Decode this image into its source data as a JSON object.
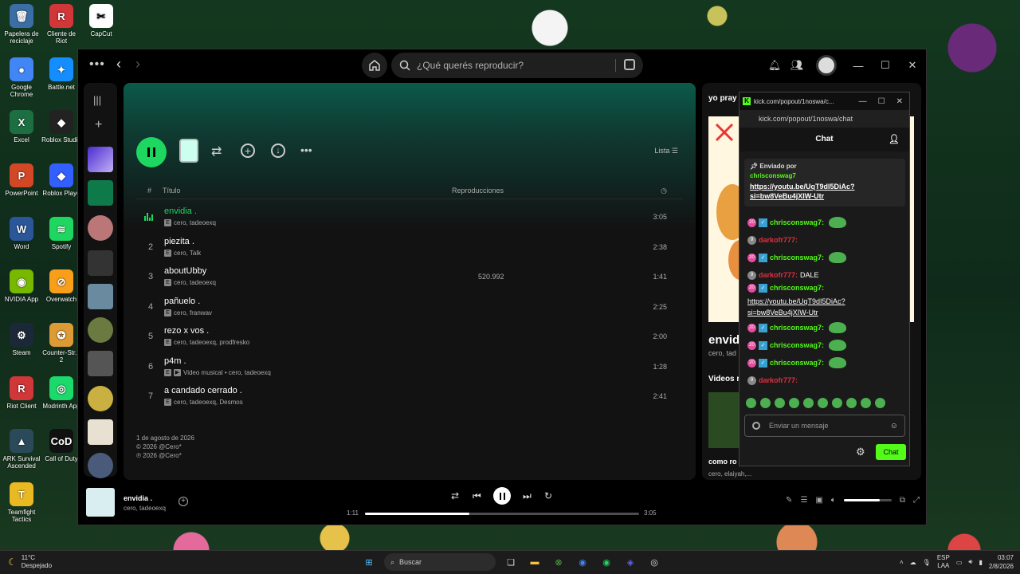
{
  "desktop": {
    "icons": [
      {
        "name": "recycle-bin",
        "label": "Papelera de reciclaje",
        "color": "#3a6ea5",
        "glyph": "🗑"
      },
      {
        "name": "riot-client",
        "label": "Cliente de Riot",
        "color": "#d13639",
        "glyph": "R"
      },
      {
        "name": "capcut",
        "label": "CapCut",
        "color": "#ffffff",
        "glyph": "✂"
      },
      {
        "name": "chrome",
        "label": "Google Chrome",
        "color": "#4285f4",
        "glyph": "●"
      },
      {
        "name": "battlenet",
        "label": "Battle.net",
        "color": "#148eff",
        "glyph": "✦"
      },
      {
        "name": "excel",
        "label": "Excel",
        "color": "#1d6f42",
        "glyph": "X"
      },
      {
        "name": "roblox-studio",
        "label": "Roblox Studio",
        "color": "#222222",
        "glyph": "◆"
      },
      {
        "name": "powerpoint",
        "label": "PowerPoint",
        "color": "#d24726",
        "glyph": "P"
      },
      {
        "name": "roblox-player",
        "label": "Roblox Playe",
        "color": "#335fff",
        "glyph": "◆"
      },
      {
        "name": "word",
        "label": "Word",
        "color": "#2b579a",
        "glyph": "W"
      },
      {
        "name": "spotify",
        "label": "Spotify",
        "color": "#1ed760",
        "glyph": "≋"
      },
      {
        "name": "nvidia",
        "label": "NVIDIA App",
        "color": "#76b900",
        "glyph": "◉"
      },
      {
        "name": "overwatch",
        "label": "Overwatch",
        "color": "#f99e1a",
        "glyph": "⊘"
      },
      {
        "name": "steam",
        "label": "Steam",
        "color": "#1b2838",
        "glyph": "⚙"
      },
      {
        "name": "counter-strike",
        "label": "Counter-Str... 2",
        "color": "#de9b35",
        "glyph": "✪"
      },
      {
        "name": "riot-client2",
        "label": "Riot Client",
        "color": "#d13639",
        "glyph": "R"
      },
      {
        "name": "modrinth",
        "label": "Modrinth App",
        "color": "#1bd96a",
        "glyph": "◎"
      },
      {
        "name": "ark",
        "label": "ARK Survival Ascended",
        "color": "#2a4a5a",
        "glyph": "▲"
      },
      {
        "name": "cod",
        "label": "Call of Duty",
        "color": "#111111",
        "glyph": "CoD"
      },
      {
        "name": "tft",
        "label": "Teamfight Tactics",
        "color": "#e8b923",
        "glyph": "T"
      }
    ]
  },
  "topbar": {
    "search_placeholder": "¿Qué querés reproducir?"
  },
  "playlist": {
    "list_label": "Lista",
    "col_num": "#",
    "col_title": "Título",
    "col_plays": "Reproducciones",
    "tracks": [
      {
        "num": "",
        "title": "envidia .",
        "artists": "cero, tadeoexq",
        "plays": "",
        "dur": "3:05",
        "video": false
      },
      {
        "num": "2",
        "title": "piezita .",
        "artists": "cero, Talk",
        "plays": "",
        "dur": "2:38",
        "video": false
      },
      {
        "num": "3",
        "title": "aboutUbby",
        "artists": "cero, tadeoexq",
        "plays": "520.992",
        "dur": "1:41",
        "video": false
      },
      {
        "num": "4",
        "title": "pañuelo .",
        "artists": "cero, franwav",
        "plays": "",
        "dur": "2:25",
        "video": false
      },
      {
        "num": "5",
        "title": "rezo x vos .",
        "artists": "cero, tadeoexq, prodfresko",
        "plays": "",
        "dur": "2:00",
        "video": false
      },
      {
        "num": "6",
        "title": "p4m .",
        "artists": "Video musical • cero, tadeoexq",
        "plays": "",
        "dur": "1:28",
        "video": true
      },
      {
        "num": "7",
        "title": "a candado cerrado .",
        "artists": "cero, tadeoexq, Desmos",
        "plays": "",
        "dur": "2:41",
        "video": false
      }
    ],
    "release_date": "1 de agosto de 2026",
    "copyright1": "© 2026 @Cero*",
    "copyright2": "℗ 2026 @Cero*"
  },
  "rightpanel": {
    "title": "yo pray .",
    "song": "envid",
    "artist": "cero, tad",
    "videos_label": "Videos r",
    "next_title": "como ro",
    "next_artists": "cero, elaiyah,..."
  },
  "player": {
    "title": "envidia .",
    "artist": "cero, tadeoexq",
    "elapsed": "1:11",
    "total": "3:05",
    "progress": 0.38,
    "volume": 0.75
  },
  "chat": {
    "window_title": "kick.com/popout/1noswa/c...",
    "url": "kick.com/popout/1noswa/chat",
    "heading": "Chat",
    "pinned_label": "Enviado por",
    "pinned_user": "chrisconswag7",
    "pinned_link": "https://youtu.be/UqT9dI5DiAc?si=bw8VeBu4jXIW-Utr",
    "messages": [
      {
        "user": "chrisconswag7:",
        "color": "g",
        "text": "",
        "emote": true,
        "badge": "20"
      },
      {
        "user": "darkofr777:",
        "color": "r",
        "text": "",
        "emote": false,
        "badge": "9"
      },
      {
        "user": "chrisconswag7:",
        "color": "g",
        "text": "",
        "emote": true,
        "badge": "20"
      },
      {
        "user": "darkofr777:",
        "color": "r",
        "text": "DALE",
        "emote": false,
        "badge": "9"
      }
    ],
    "link_msg_user": "chrisconswag7:",
    "link_msg_text": "https://youtu.be/UqT9dI5DiAc?si=bw8VeBu4jXIW-Utr",
    "messages2": [
      {
        "user": "chrisconswag7:",
        "color": "g",
        "text": "",
        "emote": true,
        "badge": "20"
      },
      {
        "user": "chrisconswag7:",
        "color": "g",
        "text": "",
        "emote": true,
        "badge": "20"
      },
      {
        "user": "chrisconswag7:",
        "color": "g",
        "text": "",
        "emote": true,
        "badge": "20"
      },
      {
        "user": "darkofr777:",
        "color": "r",
        "text": "",
        "emote": false,
        "badge": "9"
      }
    ],
    "input_placeholder": "Enviar un mensaje",
    "send_label": "Chat"
  },
  "taskbar": {
    "temp": "11°C",
    "weather": "Despejado",
    "search": "Buscar",
    "lang1": "ESP",
    "lang2": "LAA",
    "time": "03:07",
    "date": "2/8/2026"
  }
}
